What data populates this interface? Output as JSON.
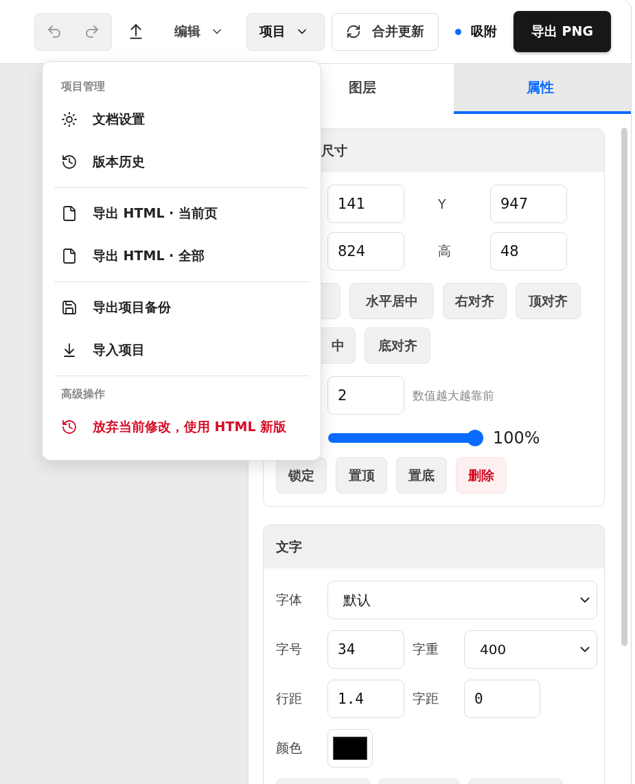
{
  "toolbar": {
    "undo": {
      "disabled": true
    },
    "redo": {
      "disabled": true
    },
    "edit_menu": {
      "label": "编辑",
      "open": false
    },
    "project_menu": {
      "label": "项目",
      "open": true
    },
    "merge_button": "合并更新",
    "snap": {
      "label": "吸附",
      "on": true
    },
    "export_button": "导出 PNG"
  },
  "project_dropdown": {
    "sections": [
      {
        "title": "项目管理",
        "items": [
          {
            "label": "文档设置",
            "kind": "normal"
          },
          {
            "label": "版本历史",
            "kind": "normal"
          }
        ]
      },
      {
        "items": [
          {
            "label": "导出 HTML · 当前页",
            "kind": "normal"
          },
          {
            "label": "导出 HTML · 全部",
            "kind": "normal"
          }
        ]
      },
      {
        "items": [
          {
            "label": "导出项目备份",
            "kind": "normal"
          },
          {
            "label": "导入项目",
            "kind": "normal"
          }
        ]
      },
      {
        "title": "高级操作",
        "items": [
          {
            "label": "放弃当前修改，使用 HTML 新版",
            "kind": "danger"
          }
        ]
      }
    ]
  },
  "tabs": [
    {
      "label": "图层",
      "selected": false
    },
    {
      "label": "属性",
      "selected": true
    }
  ],
  "size_section": {
    "title": "尺寸",
    "fields": [
      {
        "value": "141"
      },
      {
        "label": "Y",
        "value": "947"
      },
      {
        "value": "824"
      },
      {
        "label": "高",
        "value": "48"
      }
    ],
    "align_rows": [
      [
        {},
        {
          "label": "水平居中"
        },
        {
          "label": "右对齐"
        },
        {
          "label": "顶对齐"
        }
      ],
      [
        {
          "label": "中"
        },
        {
          "label": "底对齐"
        }
      ]
    ],
    "layer": {
      "value": "2",
      "hint": "数值越大越靠前"
    },
    "opacity": {
      "level": 1,
      "reading": "100%"
    },
    "actions": [
      {
        "label": "锁定",
        "kind": "normal"
      },
      {
        "label": "置顶",
        "kind": "normal"
      },
      {
        "label": "置底",
        "kind": "normal"
      },
      {
        "label": "删除",
        "kind": "danger"
      }
    ]
  },
  "text_section": {
    "title": "文字",
    "rows": [
      [
        {
          "label": "字体",
          "kind": "select",
          "value": "默认"
        }
      ],
      [
        {
          "label": "字号",
          "kind": "input",
          "value": "34"
        },
        {
          "label": "字重",
          "kind": "select",
          "value": "400"
        }
      ],
      [
        {
          "label": "行距",
          "kind": "input",
          "value": "1.4"
        },
        {
          "label": "字距",
          "kind": "input",
          "value": "0"
        }
      ],
      [
        {
          "label": "颜色",
          "kind": "color",
          "color": "#000000"
        }
      ]
    ]
  }
}
